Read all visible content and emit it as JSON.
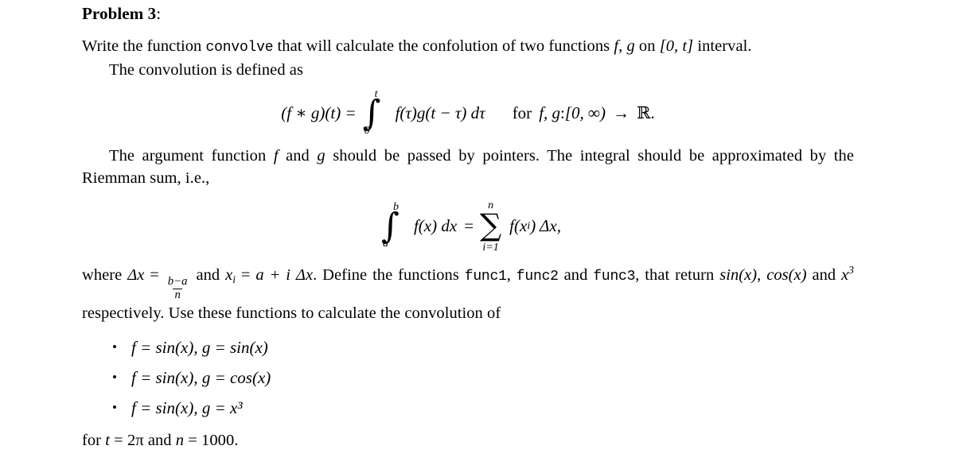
{
  "document": {
    "title_label": "Problem 3",
    "title_colon": ":",
    "paragraph1": {
      "part1": "Write the function ",
      "code": "convolve",
      "part2": " that will calculate the confolution of two functions ",
      "math_f": "f",
      "comma": ", ",
      "math_g": "g",
      "part3": " on ",
      "interval": "[0, t]",
      "part4": " interval."
    },
    "paragraph2": "The convolution is defined as",
    "equation1": {
      "lhs": "(f ∗ g)(t) =",
      "integral_symbol": "∫",
      "limit_upper": "t",
      "limit_lower": "0",
      "integrand": "f(τ)g(t − τ) dτ",
      "condition_for": "for",
      "condition_fns": "f, g",
      "condition_colon": " : ",
      "condition_domain": "[0, ∞)",
      "condition_arrow": "→",
      "condition_codomain": "ℝ",
      "condition_period": "."
    },
    "paragraph3": {
      "part1": "The argument function ",
      "math_f": "f",
      "part2": " and ",
      "math_g": "g",
      "part3": " should be passed by pointers. The integral should be approximated by the Riemman sum, i.e.,"
    },
    "equation2": {
      "integral_symbol": "∫",
      "limit_upper": "b",
      "limit_lower": "a",
      "integrand": "f(x) dx",
      "equals": "=",
      "sum_symbol": "∑",
      "sum_upper": "n",
      "sum_lower": "i=1",
      "summand": "f(x",
      "summand_sub": "i",
      "summand_close": ") Δx,"
    },
    "paragraph4": {
      "part1": "where ",
      "delta_x": "Δx",
      "equals": " = ",
      "frac_num": "b−a",
      "frac_den": "n",
      "part2": " and ",
      "x_i": "x",
      "x_i_sub": "i",
      "part3": " = ",
      "a_plus": "a + i",
      "delta_x2": " Δx",
      "part4": ". Define the functions ",
      "code1": "func1",
      "sep1": ", ",
      "code2": "func2",
      "sep2": " and ",
      "code3": "func3",
      "part5": ", that return ",
      "math_sin": "sin(x)",
      "sep3": ", ",
      "math_cos": "cos(x)",
      "part6": " and ",
      "math_x3": "x",
      "math_x3_pow": "3",
      "part7": " respectively. Use these functions to calculate the convolution of"
    },
    "bullets": [
      {
        "marker": "•",
        "text": "f = sin(x), g = sin(x)"
      },
      {
        "marker": "•",
        "text": "f = sin(x), g = cos(x)"
      },
      {
        "marker": "•",
        "text": "f = sin(x), g = x³"
      }
    ],
    "closing": {
      "part1": "for ",
      "t_var": "t",
      "eq1": " = ",
      "t_val": "2π",
      "part2": " and ",
      "n_var": "n",
      "eq2": " = ",
      "n_val": "1000",
      "period": "."
    }
  },
  "colors": {
    "text": "#000000",
    "background": "#ffffff"
  }
}
